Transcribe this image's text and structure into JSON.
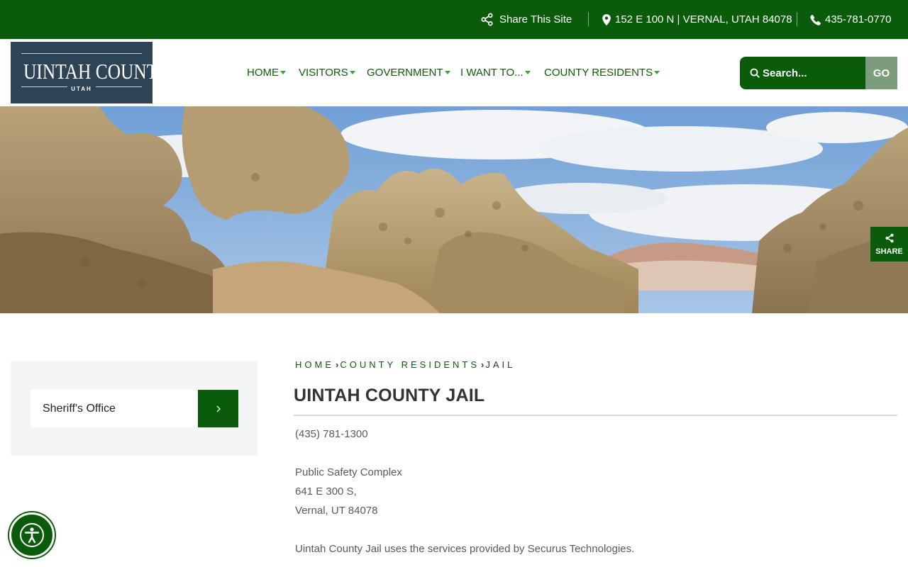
{
  "topbar": {
    "share_label": "Share This Site",
    "address": "152 E 100 N | VERNAL, UTAH 84078",
    "phone": "435-781-0770"
  },
  "logo": {
    "name": "UINTAH COUNTY",
    "state": "UTAH"
  },
  "nav": {
    "items": [
      {
        "label": "HOME"
      },
      {
        "label": "VISITORS"
      },
      {
        "label": "GOVERNMENT"
      },
      {
        "label": "I WANT TO..."
      },
      {
        "label": "COUNTY RESIDENTS"
      }
    ]
  },
  "search": {
    "placeholder": "Search...",
    "go_label": "GO"
  },
  "share_float": {
    "label": "SHARE"
  },
  "sidebar": {
    "link_label": "Sheriff's Office"
  },
  "breadcrumb": {
    "items": [
      "HOME",
      "COUNTY RESIDENTS",
      "JAIL"
    ]
  },
  "page": {
    "title": "UINTAH COUNTY JAIL",
    "phone": "(435) 781-1300",
    "address_line1": "Public Safety Complex",
    "address_line2": "641 E 300 S,",
    "address_line3": "Vernal, UT 84078",
    "description": "Uintah County Jail uses the services provided by Securus Technologies."
  },
  "colors": {
    "brand_green": "#0a5c0a",
    "logo_bg": "#2d4356",
    "go_button": "#7d9c7d"
  }
}
